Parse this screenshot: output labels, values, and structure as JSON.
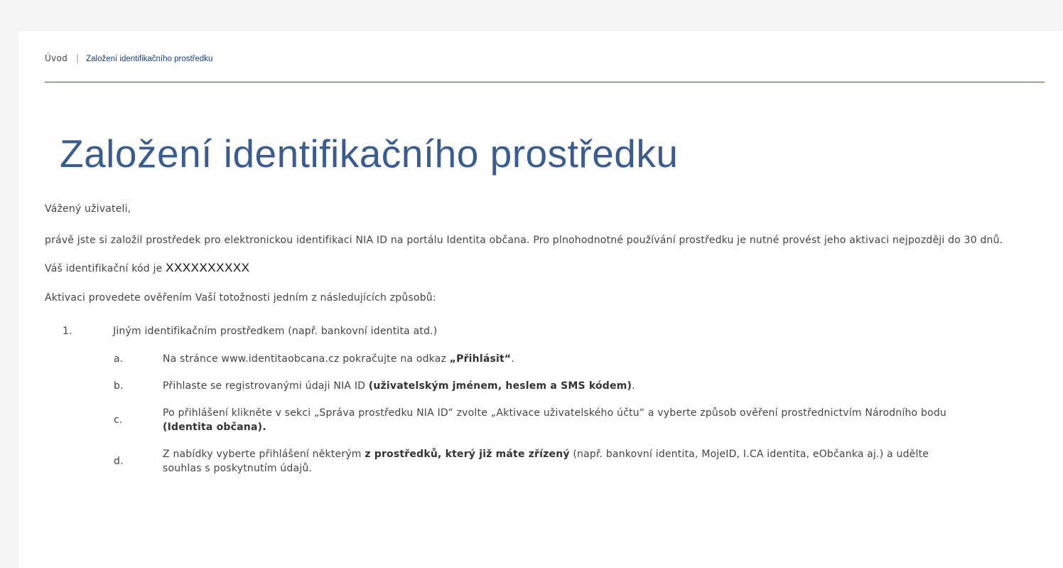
{
  "breadcrumb": {
    "home": "Úvod",
    "separator": "|",
    "current": "Založení identifikačního prostředku"
  },
  "page_title": "Založení identifikačního prostředku",
  "content": {
    "greeting": "Vážený uživateli,",
    "intro": "právě jste si založil prostředek pro elektronickou identifikaci NIA ID na portálu Identita občana. Pro plnohodnotné používání prostředku je nutné provést jeho aktivaci nejpozději do 30 dnů.",
    "code_prefix": "Váš identifikační kód je",
    "code_value": "XXXXXXXXXX",
    "methods_intro": "Aktivaci provedete ověřením Vaší totožnosti jedním z následujících způsobů:",
    "methods": [
      {
        "number": "1.",
        "text": "Jiným identifikačním prostředkem (např. bankovní identita atd.)",
        "steps": [
          {
            "letter": "a.",
            "before": "Na stránce www.identitaobcana.cz pokračujte na odkaz ",
            "bold": "„Přihlásit“",
            "after": "."
          },
          {
            "letter": "b.",
            "before": "Přihlaste se registrovanými údaji NIA ID ",
            "bold": "(uživatelským jménem, heslem a SMS kódem)",
            "after": "."
          },
          {
            "letter": "c.",
            "before": "Po přihlášení klikněte v sekci „Správa prostředku NIA ID“ zvolte „Aktivace uživatelského účtu“ a vyberte způsob ověření prostřednictvím Národního bodu ",
            "bold": "(Identita občana).",
            "after": ""
          },
          {
            "letter": "d.",
            "before": "Z nabídky vyberte přihlášení některým ",
            "bold": "z prostředků, který již máte zřízený",
            "after": " (např. bankovní identita, MojeID, I.CA identita, eObčanka aj.) a udělte souhlas s poskytnutím údajů."
          }
        ]
      }
    ]
  }
}
